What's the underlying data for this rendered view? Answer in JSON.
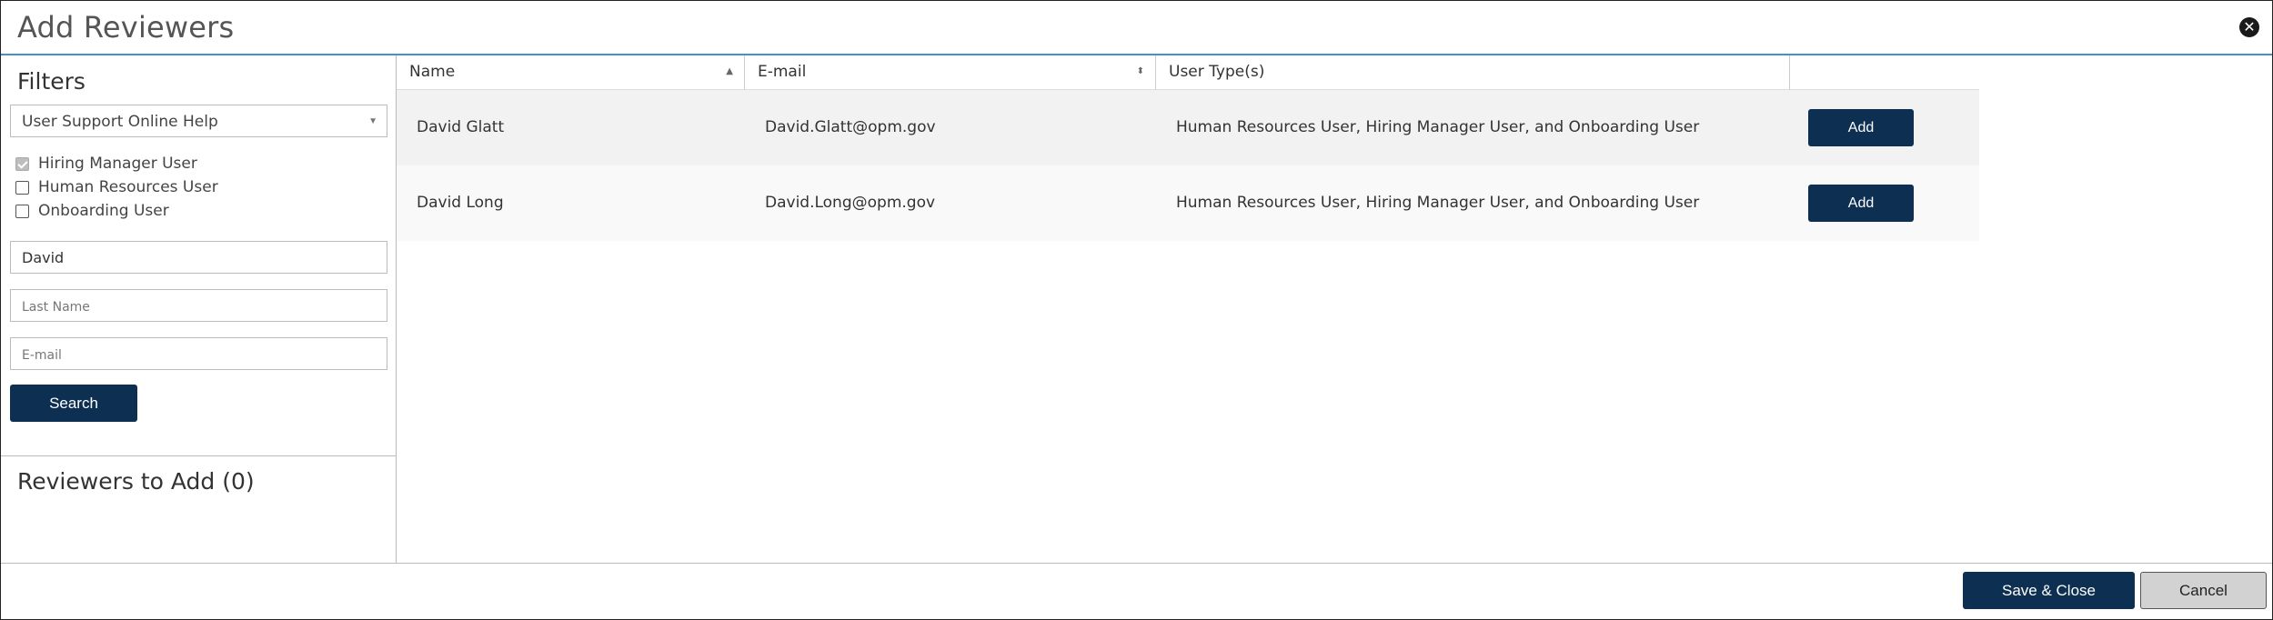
{
  "modal": {
    "title": "Add Reviewers",
    "close_icon": "close-icon"
  },
  "filters": {
    "title": "Filters",
    "dropdown_value": "User Support Online Help",
    "checkboxes": [
      {
        "label": "Hiring Manager User",
        "checked": true
      },
      {
        "label": "Human Resources User",
        "checked": false
      },
      {
        "label": "Onboarding User",
        "checked": false
      }
    ],
    "first_name_value": "David",
    "last_name_placeholder": "Last Name",
    "email_placeholder": "E-mail",
    "search_label": "Search"
  },
  "reviewers": {
    "title": "Reviewers to Add (0)"
  },
  "table": {
    "headers": [
      "Name",
      "E-mail",
      "User Type(s)"
    ],
    "rows": [
      {
        "name": "David Glatt",
        "email": "David.Glatt@opm.gov",
        "types": "Human Resources User, Hiring Manager User, and Onboarding User",
        "action": "Add"
      },
      {
        "name": "David Long",
        "email": "David.Long@opm.gov",
        "types": "Human Resources User, Hiring Manager User, and Onboarding User",
        "action": "Add"
      }
    ]
  },
  "footer": {
    "save_label": "Save & Close",
    "cancel_label": "Cancel"
  },
  "colors": {
    "primary": "#0d2f52",
    "accent_border": "#4a90c8",
    "cancel_bg": "#d2d2d2"
  }
}
